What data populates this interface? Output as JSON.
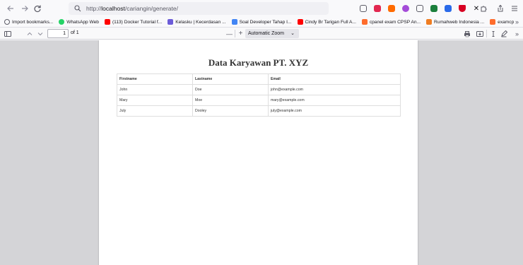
{
  "browser": {
    "url_prefix": "http://",
    "url_host": "localhost",
    "url_path": "/cariangin/generate/",
    "extensions": [
      {
        "name": "pocket-icon",
        "color": "#5b5b66"
      },
      {
        "name": "extension-red-icon",
        "color": "#e22850"
      },
      {
        "name": "extension-orange-icon",
        "color": "#ff6a00"
      },
      {
        "name": "extension-purple-icon",
        "color": "#a44bd8"
      },
      {
        "name": "shield-icon",
        "color": "#5b5b66"
      },
      {
        "name": "extension-green-icon",
        "color": "#1b7f3c"
      },
      {
        "name": "translate-icon",
        "color": "#2a6ae9"
      },
      {
        "name": "vpn-icon",
        "color": "#d70022"
      },
      {
        "name": "x-icon",
        "color": "#15141a"
      }
    ]
  },
  "bookmarks": [
    {
      "icon": "import-icon",
      "label": "Import bookmarks...",
      "color": "#5b5b66"
    },
    {
      "icon": "whatsapp-icon",
      "label": "WhatsApp Web",
      "color": "#25d366"
    },
    {
      "icon": "youtube-icon",
      "label": "(113) Docker Tutorial f...",
      "color": "#ff0000"
    },
    {
      "icon": "kelasku-icon",
      "label": "Kelasku | Kecerdasan ...",
      "color": "#6b5bd8"
    },
    {
      "icon": "docs-icon",
      "label": "Soal Developer Tahap I...",
      "color": "#4285f4"
    },
    {
      "icon": "youtube-icon",
      "label": "Cindy Br Tarigan Full A...",
      "color": "#ff0000"
    },
    {
      "icon": "cpanel-icon",
      "label": "cpanel exam CPSP An...",
      "color": "#ff6c2c"
    },
    {
      "icon": "rumahweb-icon",
      "label": "Rumahweb Indonesia ...",
      "color": "#ef7d22"
    },
    {
      "icon": "cpanel-icon",
      "label": "examcp",
      "color": "#ff6c2c"
    }
  ],
  "pdf_toolbar": {
    "page_number": "1",
    "page_total": "of 1",
    "zoom": "Automatic Zoom",
    "zoom_minus": "—",
    "zoom_plus": "+"
  },
  "document": {
    "title": "Data Karyawan PT. XYZ",
    "table": {
      "headers": [
        "Firstname",
        "Lastname",
        "Email"
      ],
      "rows": [
        [
          "John",
          "Doe",
          "john@example.com"
        ],
        [
          "Mary",
          "Moe",
          "mary@example.com"
        ],
        [
          "July",
          "Dooley",
          "july@example.com"
        ]
      ]
    }
  }
}
